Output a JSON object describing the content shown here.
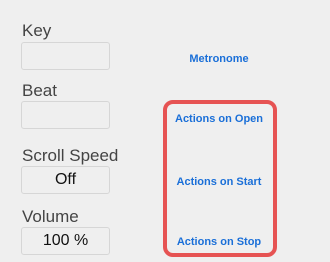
{
  "settings": {
    "key": {
      "label": "Key",
      "value": ""
    },
    "beat": {
      "label": "Beat",
      "value": ""
    },
    "scroll_speed": {
      "label": "Scroll Speed",
      "value": "Off"
    },
    "volume": {
      "label": "Volume",
      "value": "100 %"
    }
  },
  "actions": {
    "metronome": "Metronome",
    "on_open": "Actions on Open",
    "on_start": "Actions on Start",
    "on_stop": "Actions on Stop"
  },
  "colors": {
    "link": "#1a6fd8",
    "highlight": "#e65353",
    "background": "#efefef"
  }
}
